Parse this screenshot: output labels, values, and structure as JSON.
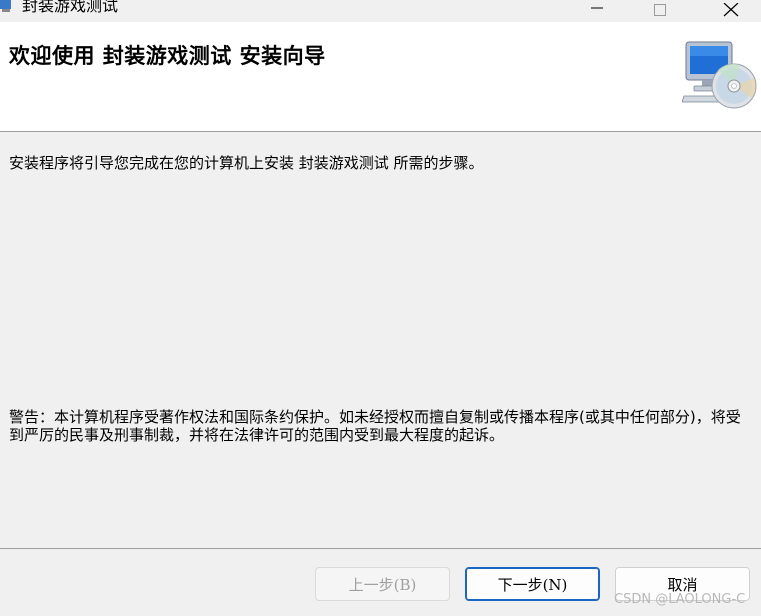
{
  "window": {
    "title": "封装游戏测试",
    "controls": {
      "minimize": "minimize-icon",
      "maximize": "maximize-icon",
      "close": "close-icon"
    }
  },
  "header": {
    "title": "欢迎使用 封装游戏测试 安装向导",
    "art_icon": "computer-cd-icon"
  },
  "body": {
    "intro": "安装程序将引导您完成在您的计算机上安装 封装游戏测试 所需的步骤。",
    "warning": "警告：本计算机程序受著作权法和国际条约保护。如未经授权而擅自复制或传播本程序(或其中任何部分)，将受到严厉的民事及刑事制裁，并将在法律许可的范围内受到最大程度的起诉。"
  },
  "buttons": {
    "back": "上一步(B)",
    "next": "下一步(N)",
    "cancel": "取消"
  },
  "watermark": "CSDN @LAOLONG-C",
  "colors": {
    "accent": "#1a66c2",
    "background": "#f0f0f0",
    "banner": "#ffffff"
  }
}
